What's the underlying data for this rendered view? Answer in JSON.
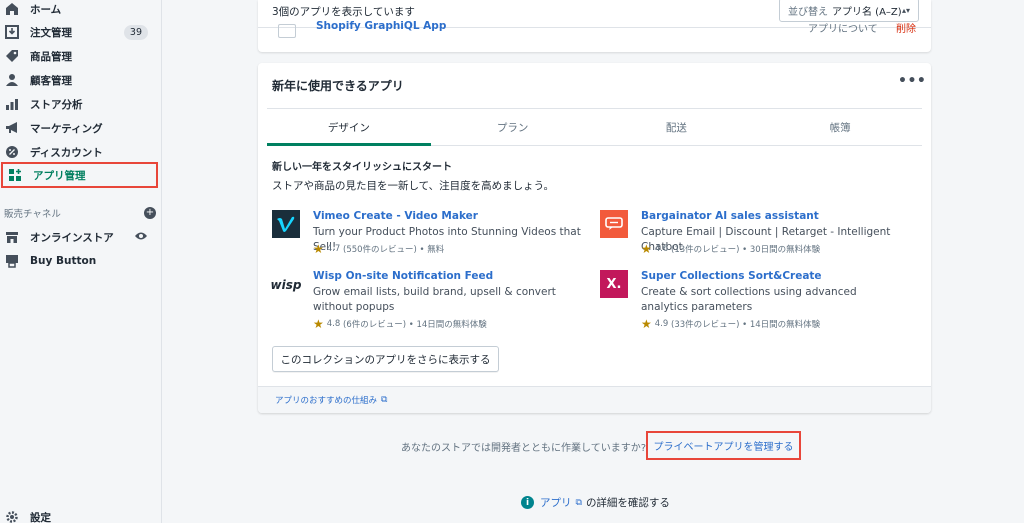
{
  "sidebar": {
    "items": [
      {
        "label": "ホーム",
        "icon": "home-icon"
      },
      {
        "label": "注文管理",
        "icon": "orders-icon",
        "badge": "39"
      },
      {
        "label": "商品管理",
        "icon": "tag-icon"
      },
      {
        "label": "顧客管理",
        "icon": "person-icon"
      },
      {
        "label": "ストア分析",
        "icon": "bar-chart-icon"
      },
      {
        "label": "マーケティング",
        "icon": "megaphone-icon"
      },
      {
        "label": "ディスカウント",
        "icon": "discount-icon"
      },
      {
        "label": "アプリ管理",
        "icon": "apps-icon"
      }
    ],
    "channels_heading": "販売チャネル",
    "channels": [
      {
        "label": "オンラインストア",
        "icon": "store-icon"
      },
      {
        "label": "Buy Button",
        "icon": "buy-button-icon"
      }
    ],
    "settings_label": "設定"
  },
  "top_card": {
    "count_text": "3個のアプリを表示しています",
    "sort_label": "並び替え",
    "sort_value": "アプリ名 (A–Z)",
    "partial_app_name": "Shopify GraphiQL App",
    "partial_app_link": "アプリについて",
    "partial_app_delete": "削除"
  },
  "collection_card": {
    "title": "新年に使用できるアプリ",
    "tabs": [
      "デザイン",
      "プラン",
      "配送",
      "帳簿"
    ],
    "active_tab": 0,
    "heading": "新しい一年をスタイリッシュにスタート",
    "description": "ストアや商品の見た目を一新して、注目度を高めましょう。",
    "apps": [
      {
        "name": "Vimeo Create - Video Maker",
        "description": "Turn your Product Photos into Stunning Videos that Sell!",
        "rating": "4.7",
        "meta": "(550件のレビュー) • 無料",
        "logo": "vimeo-logo"
      },
      {
        "name": "Bargainator AI sales assistant",
        "description": "Capture Email | Discount | Retarget - Intelligent Chatbot",
        "rating": "4.6",
        "meta": "(13件のレビュー) • 30日間の無料体験",
        "logo": "bargainator-logo"
      },
      {
        "name": "Wisp On-site Notification Feed",
        "description": "Grow email lists, build brand, upsell & convert without popups",
        "rating": "4.8",
        "meta": "(6件のレビュー) • 14日間の無料体験",
        "logo": "wisp-logo",
        "logo_text": "wisp"
      },
      {
        "name": "Super Collections Sort&Create",
        "description": "Create & sort collections using advanced analytics parameters",
        "rating": "4.9",
        "meta": "(33件のレビュー) • 14日間の無料体験",
        "logo": "super-collections-logo",
        "logo_text": "X."
      }
    ],
    "more_button": "このコレクションのアプリをさらに表示する",
    "footer_link": "アプリのおすすめの仕組み"
  },
  "bottom": {
    "developer_question": "あなたのストアでは開発者とともに作業していますか?",
    "private_apps_link": "プライベートアプリを管理する",
    "learn_link": "アプリ",
    "learn_suffix": "の詳細を確認する"
  },
  "colors": {
    "accent_green": "#008060",
    "link_blue": "#2c6ecb",
    "highlight_red": "#e8463a",
    "star": "#b98900"
  }
}
